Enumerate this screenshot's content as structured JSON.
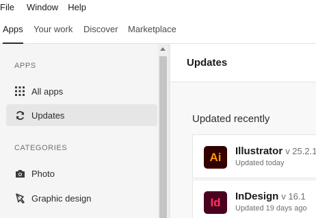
{
  "menubar": {
    "items": [
      "File",
      "Window",
      "Help"
    ]
  },
  "tabs": [
    {
      "label": "Apps",
      "active": true
    },
    {
      "label": "Your work",
      "active": false
    },
    {
      "label": "Discover",
      "active": false
    },
    {
      "label": "Marketplace",
      "active": false
    }
  ],
  "sidebar": {
    "apps_section": "APPS",
    "categories_section": "CATEGORIES",
    "items": [
      {
        "label": "All apps",
        "icon": "grid-icon",
        "active": false
      },
      {
        "label": "Updates",
        "icon": "refresh-icon",
        "active": true
      },
      {
        "label": "Photo",
        "icon": "camera-icon",
        "active": false
      },
      {
        "label": "Graphic design",
        "icon": "pen-tool-icon",
        "active": false
      }
    ]
  },
  "main": {
    "title": "Updates",
    "section_heading": "Updated recently",
    "apps": [
      {
        "abbr": "Ai",
        "name": "Illustrator",
        "version": "v 25.2.1",
        "status": "Updated today",
        "icon_bg": "#330000",
        "icon_fg": "#ff9a00"
      },
      {
        "abbr": "Id",
        "name": "InDesign",
        "version": "v 16.1",
        "status": "Updated 19 days ago",
        "icon_bg": "#49021f",
        "icon_fg": "#ff3366"
      }
    ]
  },
  "colors": {
    "sidebar_bg": "#f5f5f5",
    "active_item_bg": "#e6e6e6",
    "main_bg": "#f8f8f8"
  }
}
